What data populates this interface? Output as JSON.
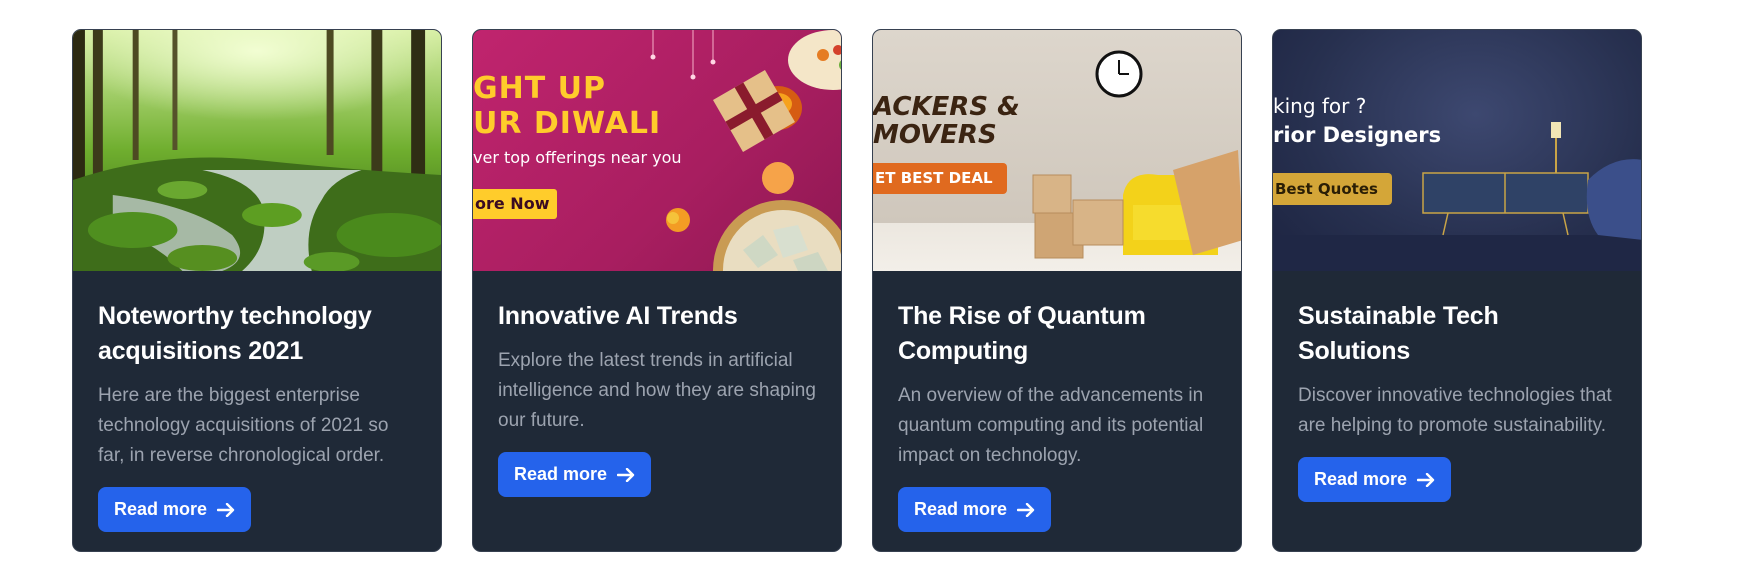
{
  "cards": [
    {
      "image": {
        "alt": "Forest stream",
        "kind": "forest-photo"
      },
      "title": "Noteworthy technology acquisitions 2021",
      "description": "Here are the biggest enterprise technology acquisitions of 2021 so far, in reverse chronological order.",
      "button_label": "Read more"
    },
    {
      "image": {
        "kind": "diwali-banner",
        "line1": "GHT UP",
        "line2": "UR DIWALI",
        "line3": "ver top offerings near you",
        "button": "ore Now"
      },
      "title": "Innovative AI Trends",
      "description": "Explore the latest trends in artificial intelligence and how they are shaping our future.",
      "button_label": "Read more"
    },
    {
      "image": {
        "kind": "movers-banner",
        "line1": "ACKERS &",
        "line2": "MOVERS",
        "button": "ET BEST DEAL"
      },
      "title": "The Rise of Quantum Computing",
      "description": "An overview of the advancements in quantum computing and its potential impact on technology.",
      "button_label": "Read more"
    },
    {
      "image": {
        "kind": "interior-banner",
        "line1": "king for ?",
        "line2": "rior Designers",
        "button": "Best Quotes"
      },
      "title": "Sustainable Tech Solutions",
      "description": "Discover innovative technologies that are helping to promote sustainability.",
      "button_label": "Read more"
    }
  ],
  "colors": {
    "card_bg": "#1f2937",
    "title": "#ffffff",
    "description": "#9ca3af",
    "button_bg": "#2563eb",
    "diwali_bg": "#b8246a",
    "diwali_text": "#ffcc2b",
    "movers_accent": "#e06a1f",
    "interior_bg": "#27304f",
    "interior_button": "#d4a638"
  },
  "icons": {
    "button_arrow": "arrow-right-icon"
  }
}
